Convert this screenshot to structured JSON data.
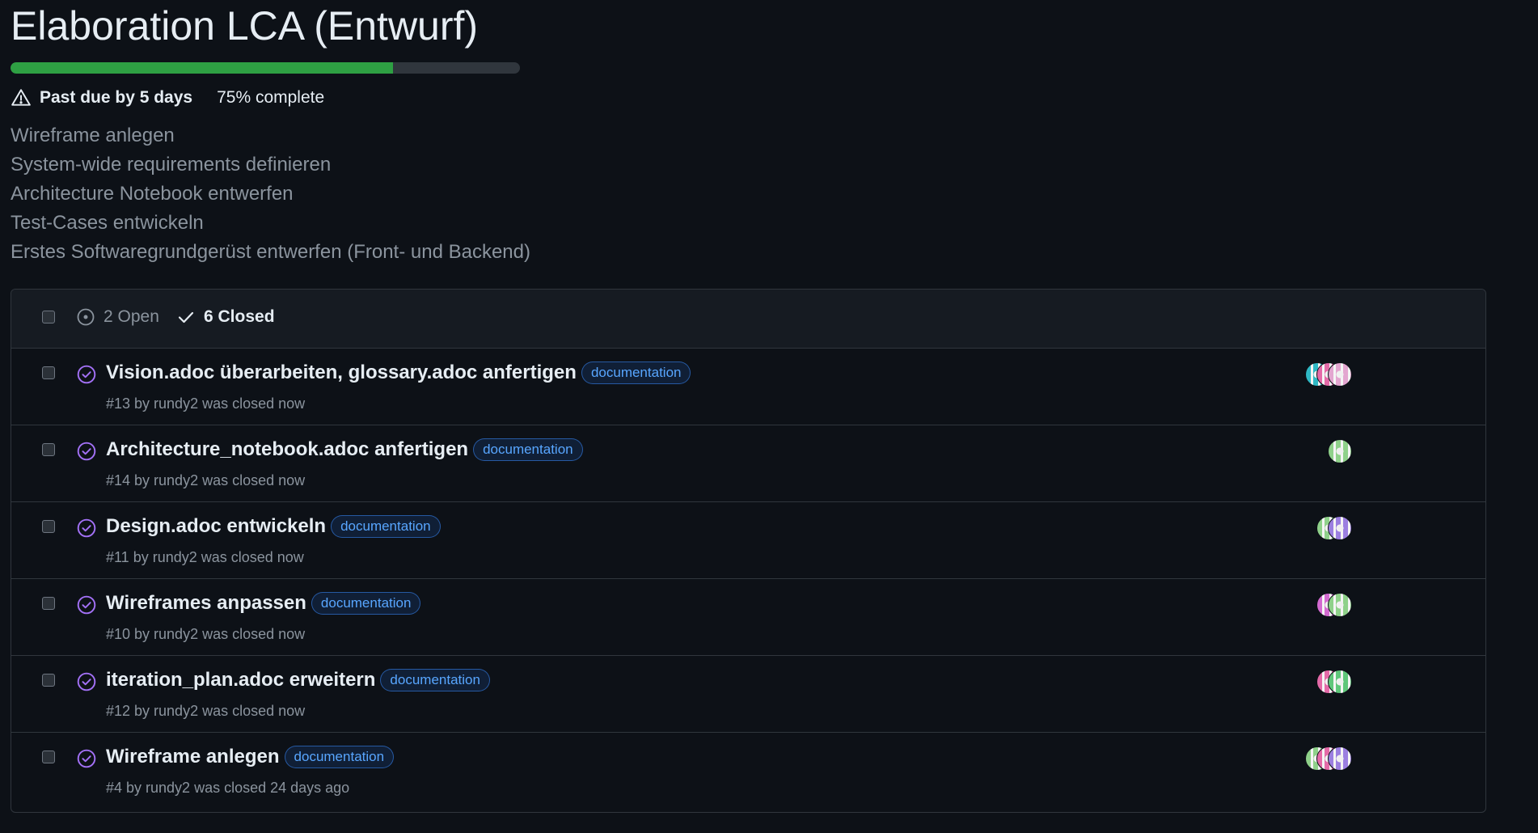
{
  "milestone": {
    "title": "Elaboration LCA (Entwurf)",
    "progress_percent": 75,
    "past_due": "Past due by 5 days",
    "complete": "75% complete",
    "description_lines": [
      "Wireframe anlegen",
      "System-wide requirements definieren",
      "Architecture Notebook entwerfen",
      "Test-Cases entwickeln",
      "Erstes Softwaregrundgerüst entwerfen (Front- und Backend)"
    ]
  },
  "colors": {
    "progress_fill": "#2ea043",
    "progress_track": "#30363d",
    "closed_icon": "#a371f7",
    "label_text": "#58a6ff"
  },
  "filters": {
    "open": "2 Open",
    "closed": "6 Closed"
  },
  "issues": [
    {
      "title": "Vision.adoc überarbeiten, glossary.adoc anfertigen",
      "label": "documentation",
      "meta": "#13 by rundy2 was closed now",
      "avatar_colors": [
        "#e3a6d0",
        "#e46aa8",
        "#2fb8c4"
      ]
    },
    {
      "title": "Architecture_notebook.adoc anfertigen",
      "label": "documentation",
      "meta": "#14 by rundy2 was closed now",
      "avatar_colors": [
        "#8fd18a"
      ]
    },
    {
      "title": "Design.adoc entwickeln",
      "label": "documentation",
      "meta": "#11 by rundy2 was closed now",
      "avatar_colors": [
        "#9b7fe0",
        "#8fd18a"
      ]
    },
    {
      "title": "Wireframes anpassen",
      "label": "documentation",
      "meta": "#10 by rundy2 was closed now",
      "avatar_colors": [
        "#8fd18a",
        "#d36ad0"
      ]
    },
    {
      "title": "iteration_plan.adoc erweitern",
      "label": "documentation",
      "meta": "#12 by rundy2 was closed now",
      "avatar_colors": [
        "#5fc77a",
        "#e46aa8"
      ]
    },
    {
      "title": "Wireframe anlegen",
      "label": "documentation",
      "meta": "#4 by rundy2 was closed 24 days ago",
      "avatar_colors": [
        "#9b7fe0",
        "#e46aa8",
        "#8fd18a"
      ]
    }
  ]
}
